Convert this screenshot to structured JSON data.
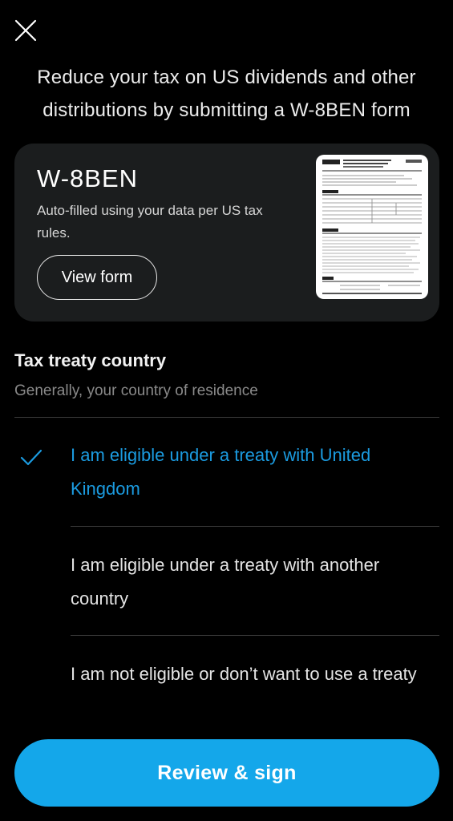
{
  "header": {
    "close_icon": "close-icon"
  },
  "intro": {
    "text": "Reduce your tax on US dividends and other distributions by submitting a W-8BEN form"
  },
  "form_card": {
    "title": "W-8BEN",
    "description": "Auto-filled using your data per US tax rules.",
    "view_button_label": "View form",
    "thumbnail_icon": "w8ben-document-thumbnail"
  },
  "treaty": {
    "title": "Tax treaty country",
    "subtitle": "Generally, your country of residence",
    "options": [
      {
        "label": "I am eligible under a treaty with United Kingdom",
        "selected": true
      },
      {
        "label": "I am eligible under a treaty with another country",
        "selected": false
      },
      {
        "label": "I am not eligible or don’t want to use a treaty",
        "selected": false
      }
    ]
  },
  "cta": {
    "label": "Review & sign"
  },
  "colors": {
    "background": "#000000",
    "card": "#1b1d1e",
    "accent": "#14a7ea",
    "selected_text": "#1b9be0",
    "muted": "#8a8a8a"
  }
}
